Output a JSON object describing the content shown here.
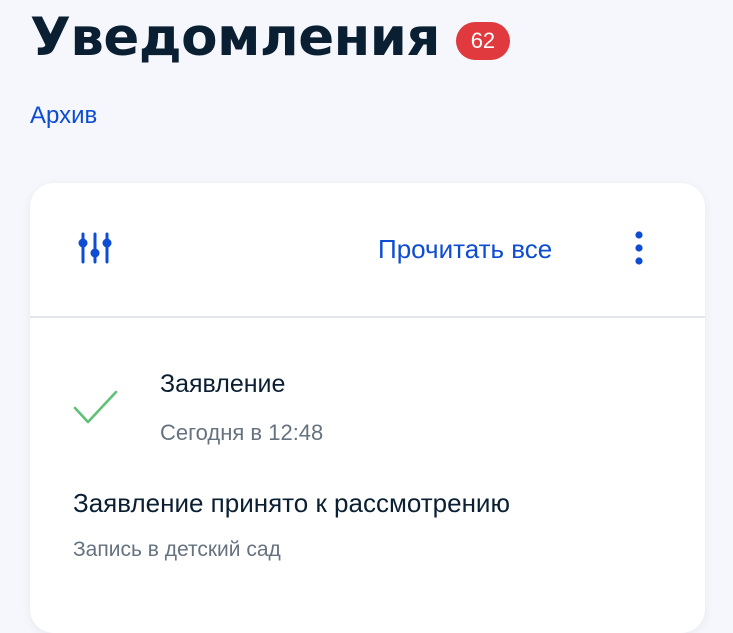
{
  "header": {
    "title": "Уведомления",
    "unread_count": "62"
  },
  "archive_link": "Архив",
  "toolbar": {
    "filter_icon": "sliders-icon",
    "read_all_label": "Прочитать все",
    "more_icon": "kebab-menu-icon"
  },
  "notifications": [
    {
      "status_icon": "check-icon",
      "title": "Заявление",
      "time": "Сегодня в 12:48",
      "message": "Заявление принято к рассмотрению",
      "subtitle": "Запись в детский сад"
    }
  ],
  "colors": {
    "background": "#f5f7fc",
    "link": "#0d4cd3",
    "badge": "#e0393e",
    "success": "#5ec175",
    "text_primary": "#0b1f33",
    "text_secondary": "#66727f"
  }
}
